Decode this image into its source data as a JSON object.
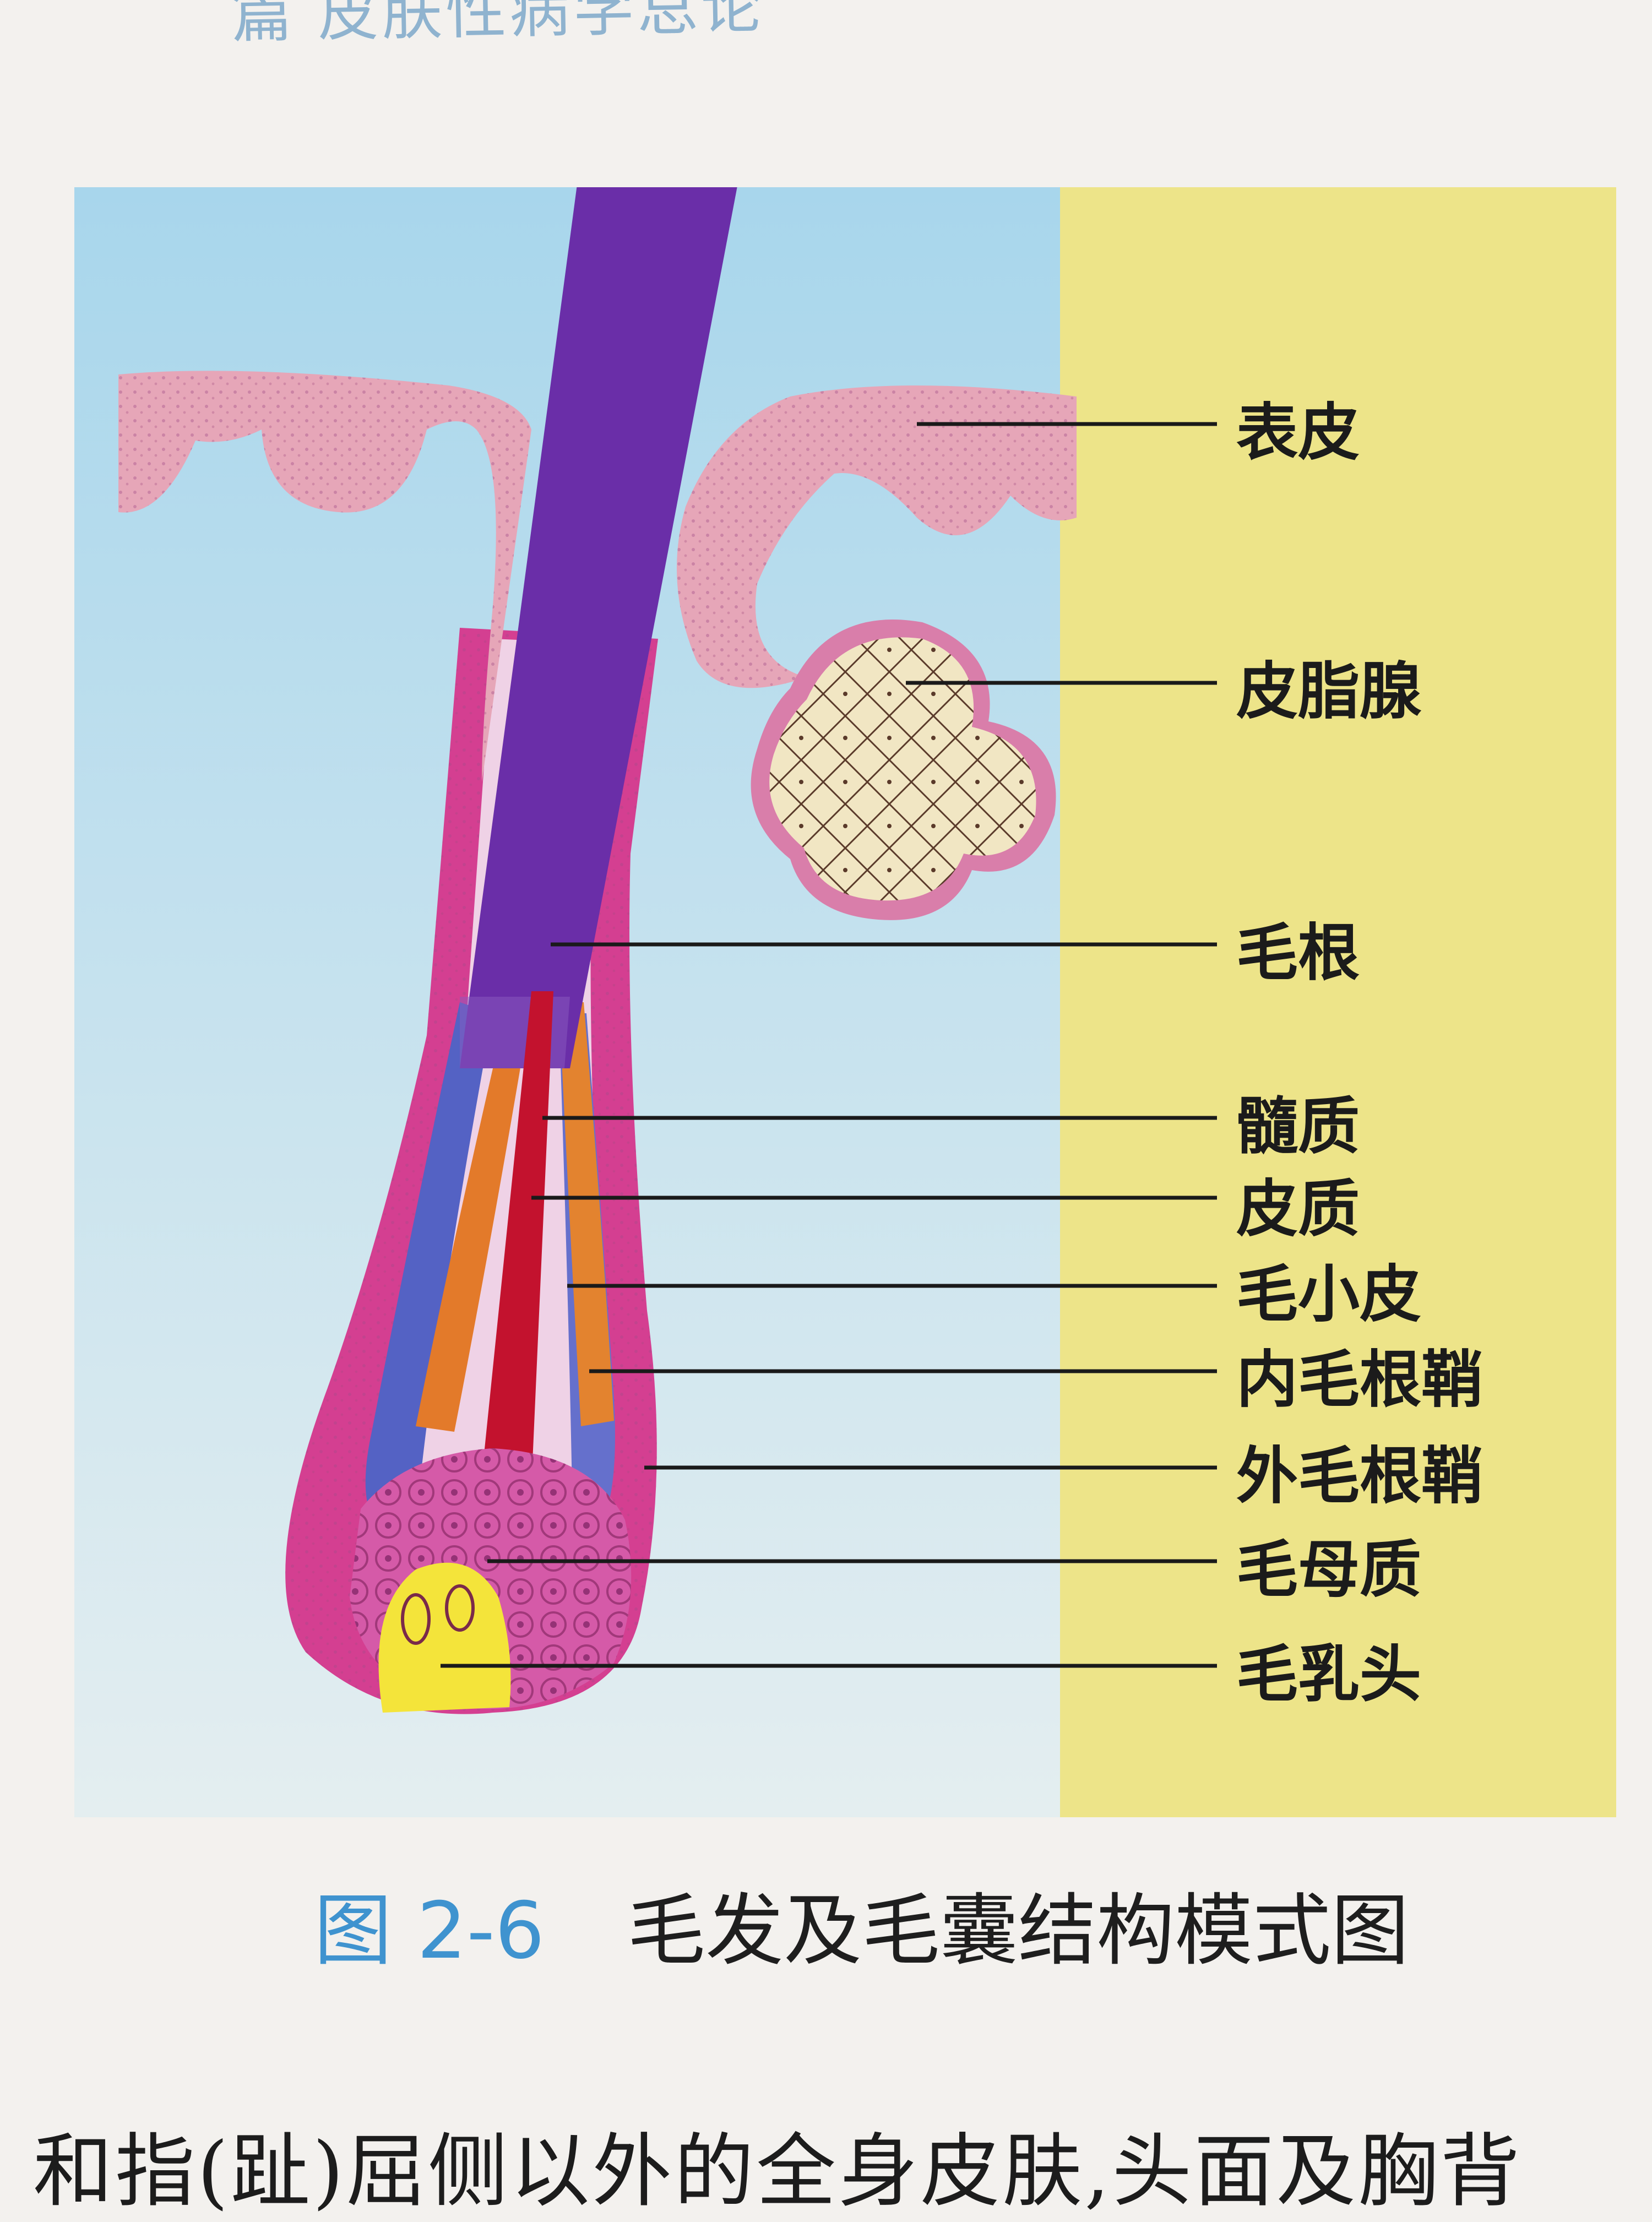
{
  "page": {
    "header_text": "篇 皮肤性病学总论",
    "caption_number": "图 2-6",
    "caption_title": "毛发及毛囊结构模式图",
    "bottom_text": "和指(趾)屈侧以外的全身皮肤,头面及胸背"
  },
  "diagram": {
    "labels": {
      "epidermis": "表皮",
      "sebaceous_gland": "皮脂腺",
      "hair_root": "毛根",
      "medulla": "髓质",
      "cortex": "皮质",
      "cuticle": "毛小皮",
      "inner_root_sheath": "内毛根鞘",
      "outer_root_sheath": "外毛根鞘",
      "hair_matrix": "毛母质",
      "dermal_papilla": "毛乳头"
    },
    "colors": {
      "background_left": "#a9d5ea",
      "background_right": "#ede389",
      "epidermis": "#e7a8ba",
      "hair_shaft": "#6a2fa6",
      "medulla": "#c3122e",
      "cortex": "#e07a2a",
      "inner_root_sheath": "#5261c6",
      "outer_root_sheath": "#d0398e",
      "sebaceous_gland": "#efe4c2",
      "dermal_papilla": "#f6e63a"
    }
  }
}
